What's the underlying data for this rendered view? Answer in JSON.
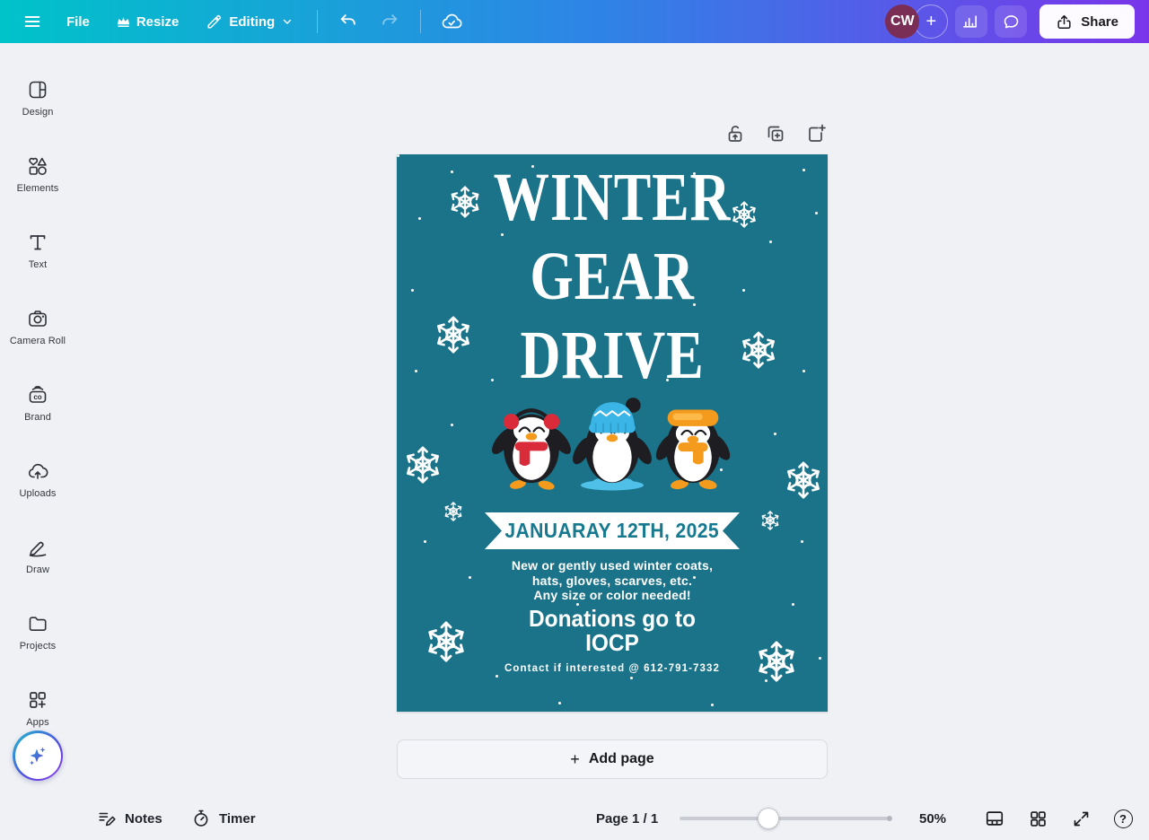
{
  "topbar": {
    "file_label": "File",
    "resize_label": "Resize",
    "editing_label": "Editing",
    "avatar_initials": "CW",
    "add_member_glyph": "+",
    "share_label": "Share"
  },
  "sidebar": {
    "items": [
      {
        "id": "design",
        "label": "Design"
      },
      {
        "id": "elements",
        "label": "Elements"
      },
      {
        "id": "text",
        "label": "Text"
      },
      {
        "id": "camera-roll",
        "label": "Camera Roll"
      },
      {
        "id": "brand",
        "label": "Brand"
      },
      {
        "id": "uploads",
        "label": "Uploads"
      },
      {
        "id": "draw",
        "label": "Draw"
      },
      {
        "id": "projects",
        "label": "Projects"
      },
      {
        "id": "apps",
        "label": "Apps"
      }
    ],
    "brand_badge_text": "co"
  },
  "poster": {
    "title_lines": [
      "WINTER",
      "GEAR",
      "DRIVE"
    ],
    "date_banner": "JANUARAY 12TH, 2025",
    "details_lines": [
      "New or gently used winter coats,",
      "hats, gloves, scarves, etc.",
      "Any size or color needed!"
    ],
    "donation_lines": [
      "Donations go to",
      "IOCP"
    ],
    "contact_line": "Contact if interested @ 612-791-7332",
    "illustration_alt": "Three cartoon penguins wearing red earmuffs, a blue beanie, and orange ski goggles",
    "colors": {
      "background": "#1a7389",
      "title_text": "#ffffff",
      "banner_bg": "#ffffff",
      "banner_text": "#16798f",
      "accent_red": "#d92b39",
      "accent_blue": "#3ab5e6",
      "accent_orange": "#f49a1c"
    }
  },
  "page_controls": {
    "add_page_label": "Add page",
    "plus_glyph": "+"
  },
  "bottombar": {
    "notes_label": "Notes",
    "timer_label": "Timer",
    "page_indicator": "Page 1 / 1",
    "zoom_level": "50%",
    "zoom_slider_percent": 42,
    "help_glyph": "?"
  }
}
